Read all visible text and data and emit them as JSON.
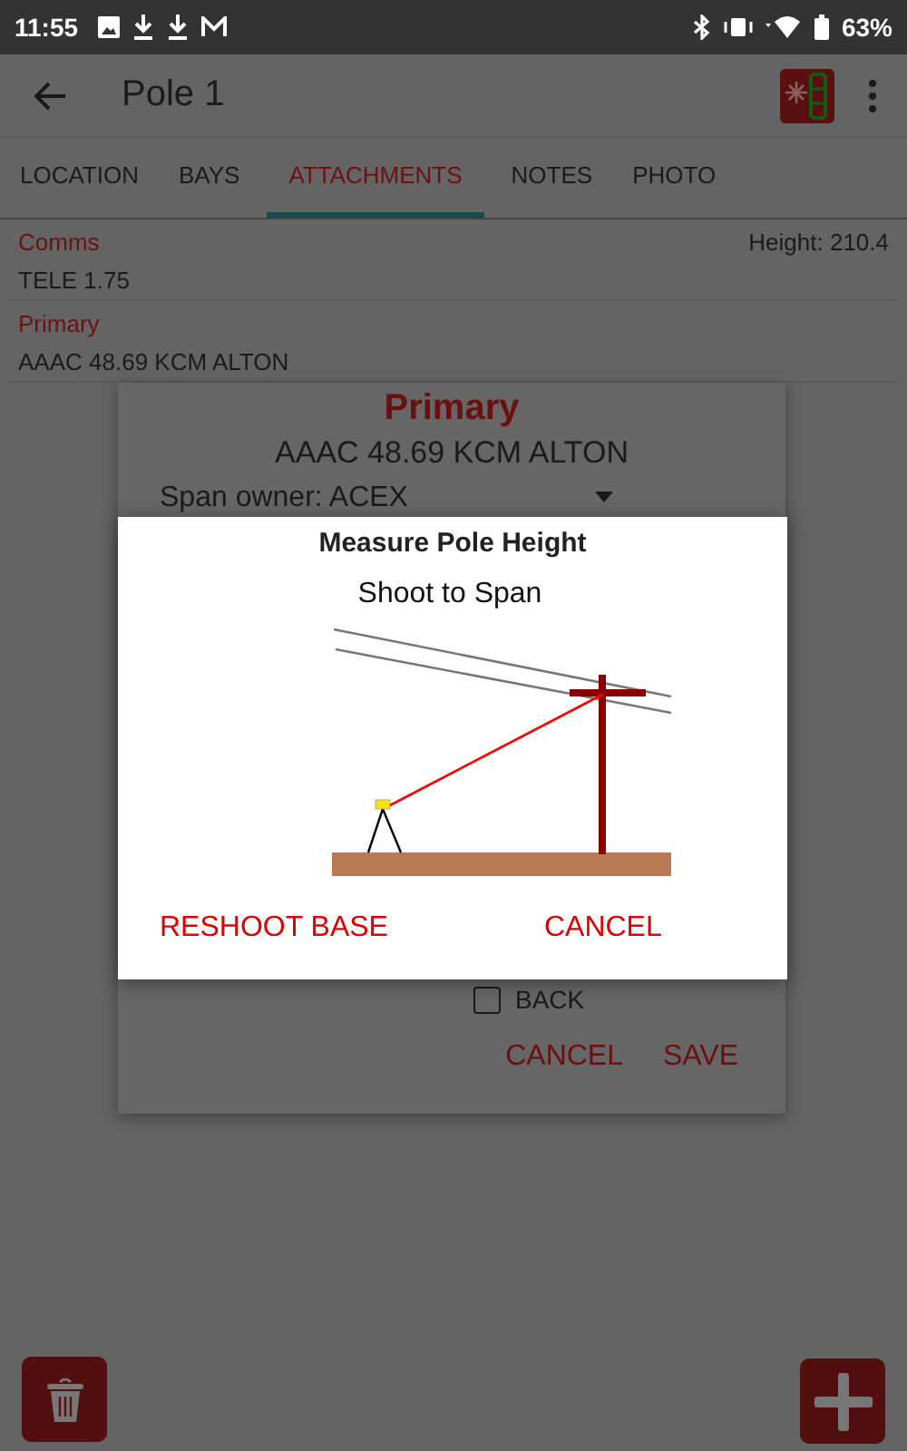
{
  "status_bar": {
    "time": "11:55",
    "battery": "63%"
  },
  "app_bar": {
    "title": "Pole 1"
  },
  "tabs": [
    {
      "label": "LOCATION",
      "selected": false
    },
    {
      "label": "BAYS",
      "selected": false
    },
    {
      "label": "ATTACHMENTS",
      "selected": true
    },
    {
      "label": "NOTES",
      "selected": false
    },
    {
      "label": "PHOTO",
      "selected": false
    }
  ],
  "attachments": [
    {
      "category": "Comms",
      "value": "TELE 1.75",
      "height": "Height: 210.4"
    },
    {
      "category": "Primary",
      "value": "AAAC 48.69 KCM ALTON"
    }
  ],
  "edit_dialog": {
    "title": "Primary",
    "subtitle": "AAAC 48.69 KCM ALTON",
    "span_owner": "Span owner: ACEX",
    "checkbox": {
      "label": "BACK",
      "checked": false
    },
    "buttons": [
      "CANCEL",
      "SAVE"
    ]
  },
  "measure_dialog": {
    "title": "Measure Pole Height",
    "instruction": "Shoot to Span",
    "buttons": [
      "RESHOOT BASE",
      "CANCEL"
    ]
  }
}
